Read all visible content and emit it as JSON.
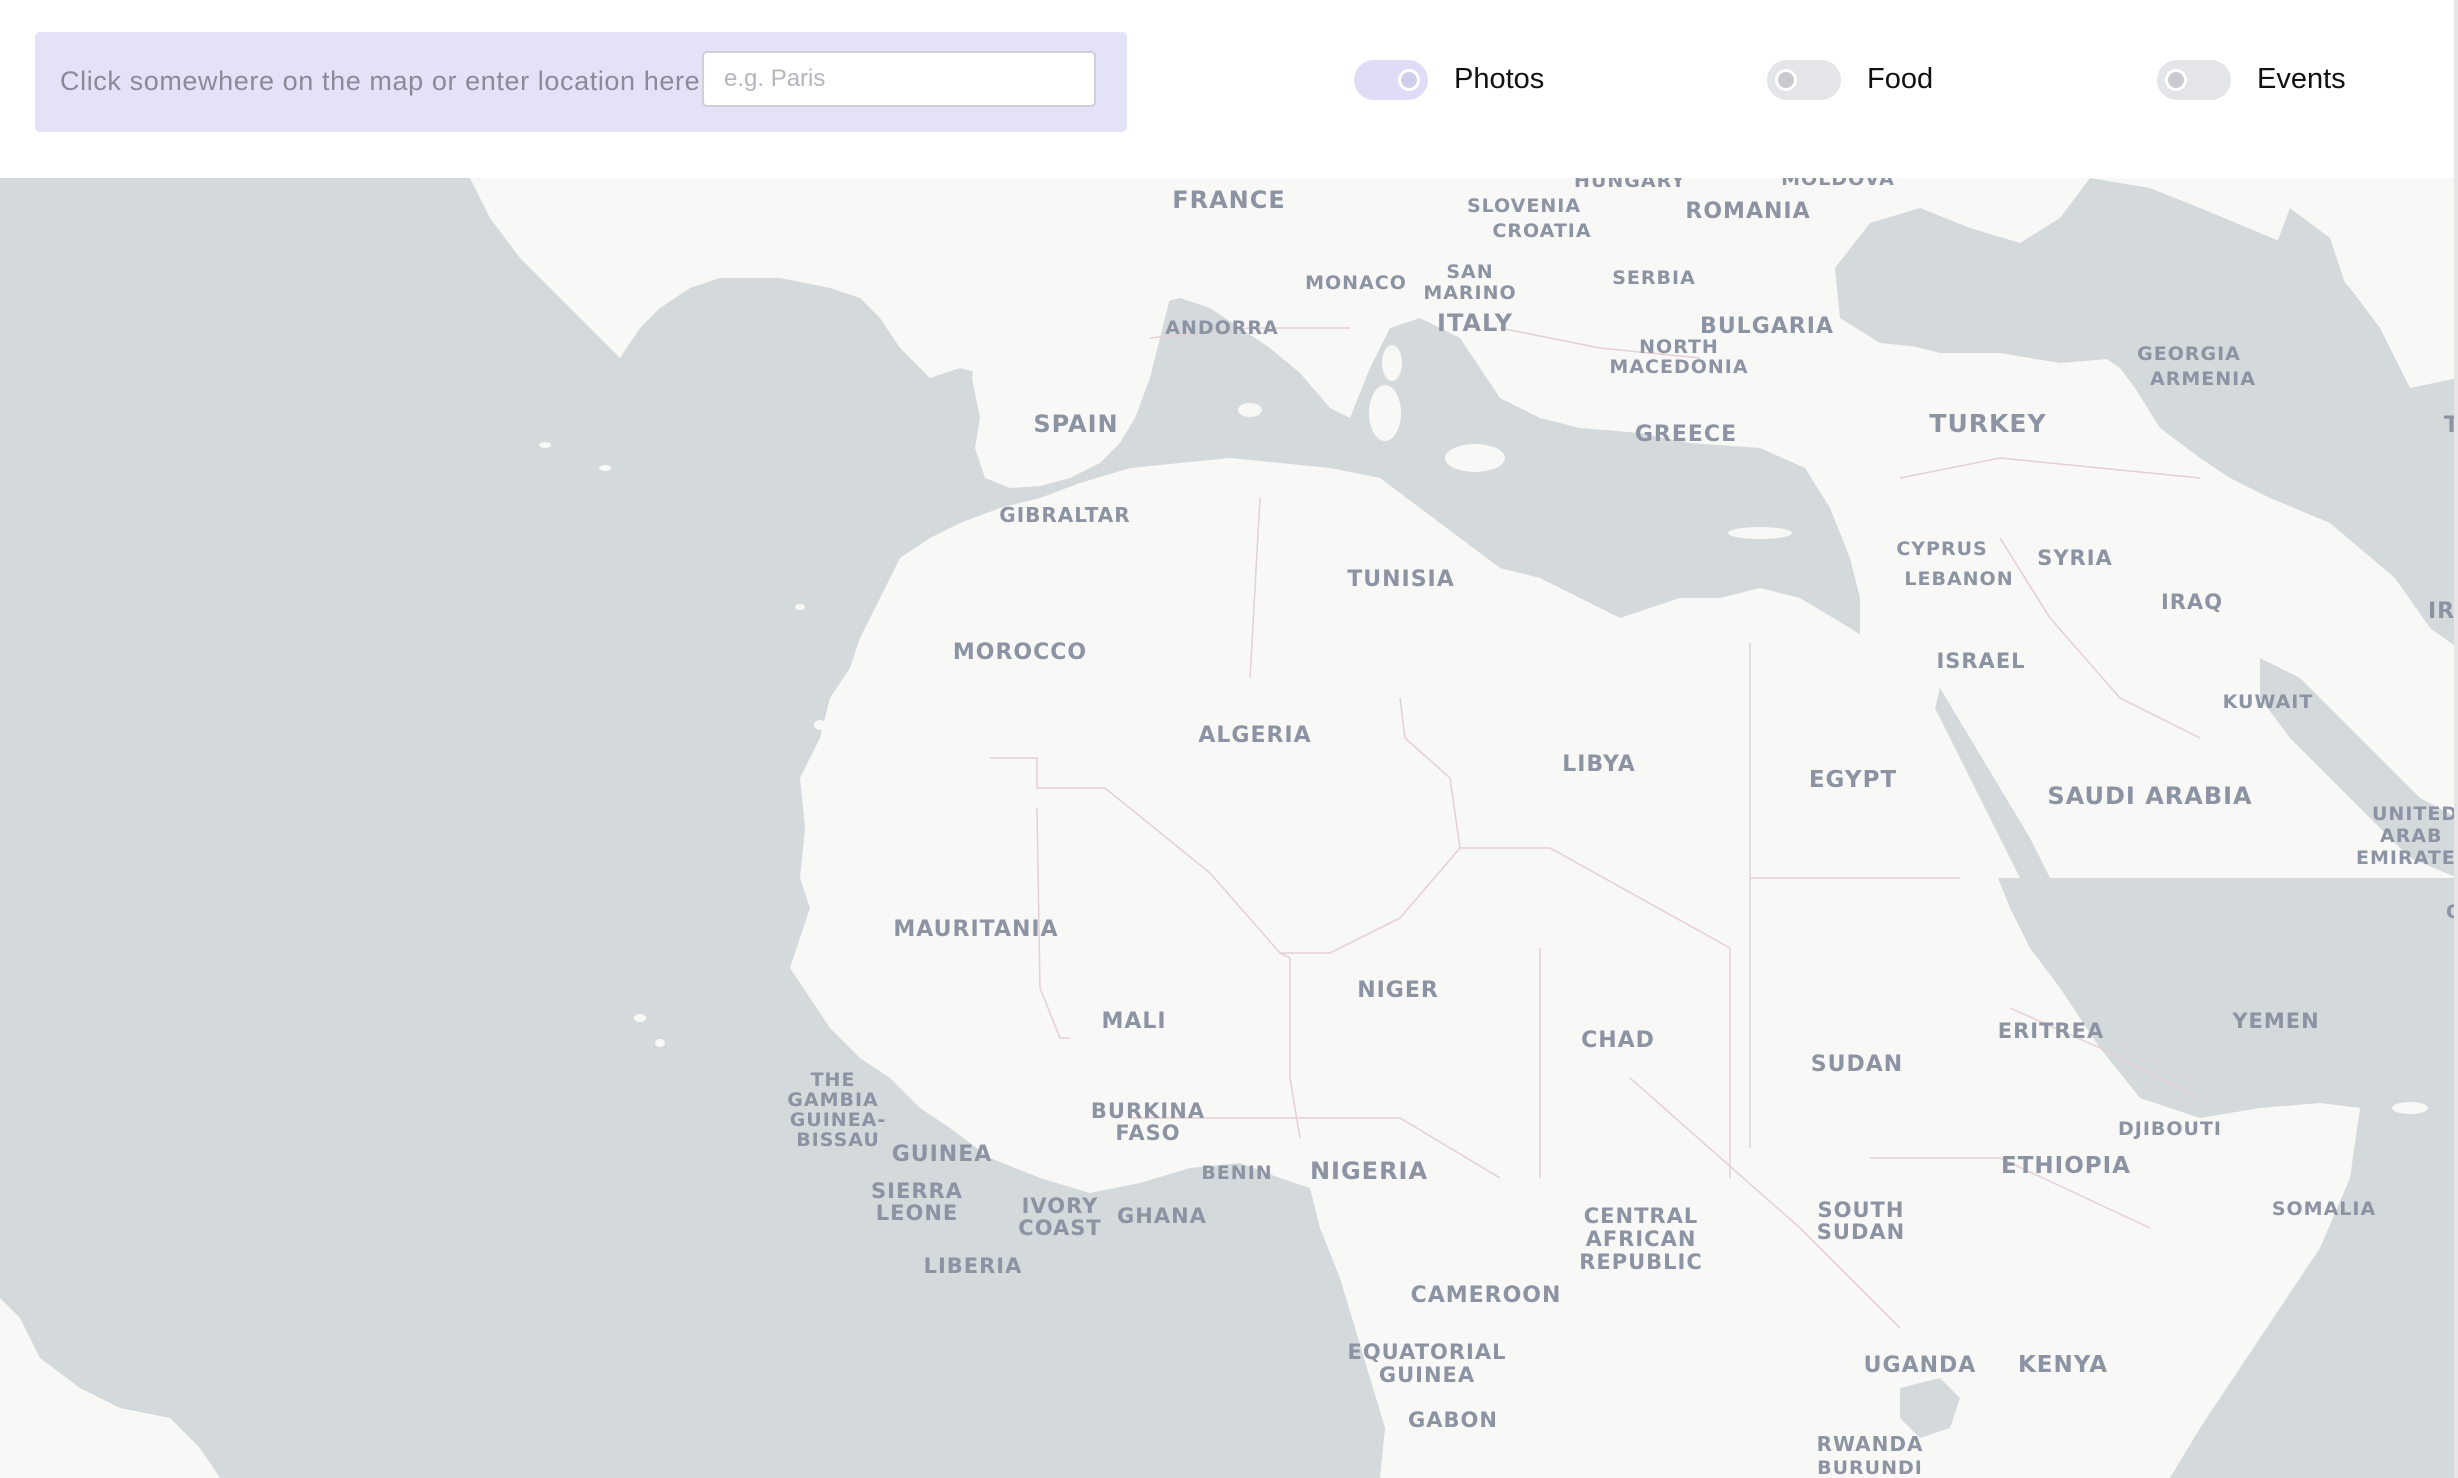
{
  "search": {
    "label": "Click somewhere on the map or enter location here:",
    "placeholder": "e.g. Paris",
    "value": ""
  },
  "toggles": [
    {
      "label": "Photos",
      "state": "on"
    },
    {
      "label": "Food",
      "state": "off"
    },
    {
      "label": "Events",
      "state": "off"
    }
  ],
  "colors": {
    "panel": "#e3e2f7",
    "toggle_on": "#dedcf6",
    "toggle_off": "#e4e5e8",
    "water": "#d4d9dc",
    "land": "#f8f8f7",
    "label": "#8c93a2"
  },
  "map": {
    "countries": {
      "france": "FRANCE",
      "hungary": "HUNGARY",
      "moldova": "MOLDOVA",
      "slovenia": "SLOVENIA",
      "croatia": "CROATIA",
      "romania": "ROMANIA",
      "monaco": "MONACO",
      "san_marino_1": "SAN",
      "san_marino_2": "MARINO",
      "serbia": "SERBIA",
      "andorra": "ANDORRA",
      "italy": "ITALY",
      "bulgaria": "BULGARIA",
      "north_macedonia_1": "NORTH",
      "north_macedonia_2": "MACEDONIA",
      "georgia": "GEORGIA",
      "armenia": "ARMENIA",
      "spain": "SPAIN",
      "greece": "GREECE",
      "turkey": "TURKEY",
      "turkmenistan_cut": "T",
      "gibraltar": "GIBRALTAR",
      "cyprus": "CYPRUS",
      "syria": "SYRIA",
      "lebanon": "LEBANON",
      "tunisia": "TUNISIA",
      "iraq": "IRAQ",
      "iran_cut": "IRAN",
      "israel": "ISRAEL",
      "morocco": "MOROCCO",
      "kuwait": "KUWAIT",
      "algeria": "ALGERIA",
      "libya": "LIBYA",
      "egypt": "EGYPT",
      "saudi_arabia": "SAUDI ARABIA",
      "uae_1": "UNITED",
      "uae_2": "ARAB",
      "uae_3": "EMIRATE",
      "oman_cut": "O",
      "mauritania": "MAURITANIA",
      "niger": "NIGER",
      "mali": "MALI",
      "chad": "CHAD",
      "eritrea": "ERITREA",
      "yemen": "YEMEN",
      "sudan": "SUDAN",
      "gambia_1": "THE",
      "gambia_2": "GAMBIA",
      "guinea_bissau_1": "GUINEA-",
      "guinea_bissau_2": "BISSAU",
      "burkina_1": "BURKINA",
      "burkina_2": "FASO",
      "djibouti": "DJIBOUTI",
      "guinea": "GUINEA",
      "benin": "BENIN",
      "nigeria": "NIGERIA",
      "ethiopia": "ETHIOPIA",
      "sierra_leone_1": "SIERRA",
      "sierra_leone_2": "LEONE",
      "ivory_coast_1": "IVORY",
      "ivory_coast_2": "COAST",
      "ghana": "GHANA",
      "car_1": "CENTRAL",
      "car_2": "AFRICAN",
      "car_3": "REPUBLIC",
      "south_sudan_1": "SOUTH",
      "south_sudan_2": "SUDAN",
      "somalia": "SOMALIA",
      "liberia": "LIBERIA",
      "cameroon": "CAMEROON",
      "eq_guinea_1": "EQUATORIAL",
      "eq_guinea_2": "GUINEA",
      "uganda": "UGANDA",
      "kenya": "KENYA",
      "gabon": "GABON",
      "rwanda": "RWANDA",
      "burundi": "BURUNDI"
    }
  }
}
